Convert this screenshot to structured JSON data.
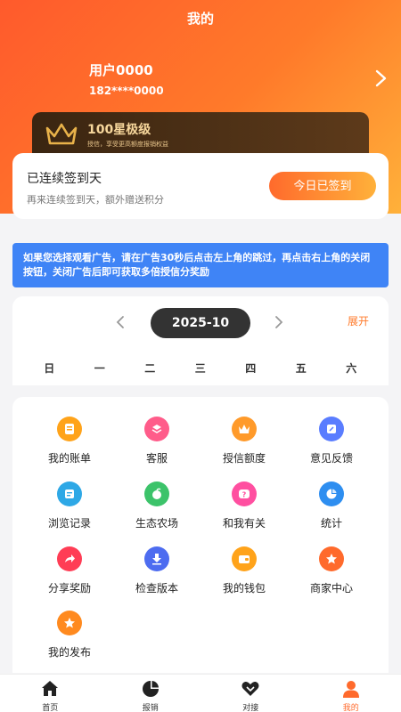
{
  "header": {
    "title": "我的"
  },
  "user": {
    "name": "用户0000",
    "phone": "182****0000"
  },
  "vip": {
    "level": "100星极级",
    "desc": "授信，享受更高额度报销权益"
  },
  "sign": {
    "title": "已连续签到天",
    "subtitle": "再来连续签到天，额外赠送积分",
    "button": "今日已签到"
  },
  "notice": {
    "text": "如果您选择观看广告，请在广告30秒后点击左上角的跳过，再点击右上角的关闭按钮，关闭广告后即可获取多倍授信分奖励"
  },
  "calendar": {
    "month": "2025-10",
    "expand": "展开",
    "weekdays": [
      "日",
      "一",
      "二",
      "三",
      "四",
      "五",
      "六"
    ]
  },
  "menu": [
    {
      "label": "我的账单",
      "icon": "bill-icon",
      "color": "#ffa31a"
    },
    {
      "label": "客服",
      "icon": "customer-service-icon",
      "color": "#ff5c8a"
    },
    {
      "label": "授信额度",
      "icon": "crown-icon",
      "color": "#ff9a2a"
    },
    {
      "label": "意见反馈",
      "icon": "feedback-icon",
      "color": "#5a7dff"
    },
    {
      "label": "浏览记录",
      "icon": "history-icon",
      "color": "#2ea8e6"
    },
    {
      "label": "生态农场",
      "icon": "farm-icon",
      "color": "#3cc36a"
    },
    {
      "label": "和我有关",
      "icon": "question-icon",
      "color": "#ff4fa0"
    },
    {
      "label": "统计",
      "icon": "pie-chart-icon",
      "color": "#2e8ef0"
    },
    {
      "label": "分享奖励",
      "icon": "share-icon",
      "color": "#ff3d55"
    },
    {
      "label": "检查版本",
      "icon": "download-icon",
      "color": "#4d6cf0"
    },
    {
      "label": "我的钱包",
      "icon": "wallet-icon",
      "color": "#ffa31a"
    },
    {
      "label": "商家中心",
      "icon": "star-icon",
      "color": "#ff6a2c"
    },
    {
      "label": "我的发布",
      "icon": "publish-star-icon",
      "color": "#ff8a1f"
    }
  ],
  "tabs": [
    {
      "label": "首页",
      "icon": "home-icon"
    },
    {
      "label": "报销",
      "icon": "pie-icon"
    },
    {
      "label": "对接",
      "icon": "handshake-icon"
    },
    {
      "label": "我的",
      "icon": "user-icon"
    }
  ],
  "colors": {
    "accent": "#ff6a2c",
    "notice": "#3f84f6",
    "vip_bg": "#3a2511"
  }
}
